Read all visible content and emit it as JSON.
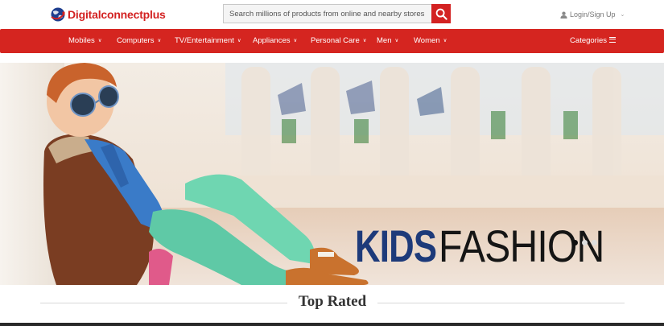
{
  "header": {
    "logo_text": "Digitalconnectplus",
    "search_placeholder": "Search millions of products from online and nearby stores",
    "login_label": "Login/Sign Up"
  },
  "nav": {
    "items": [
      {
        "label": "Mobiles"
      },
      {
        "label": "Computers"
      },
      {
        "label": "TV/Entertainment"
      },
      {
        "label": "Appliances"
      },
      {
        "label": "Personal Care"
      },
      {
        "label": "Men"
      },
      {
        "label": "Women"
      }
    ],
    "categories_label": "Categories"
  },
  "banner": {
    "title_bold": "KIDS",
    "title_light": "FASHION",
    "active_slide": 1,
    "slide_count": 3
  },
  "section": {
    "title": "Top Rated"
  },
  "colors": {
    "brand_red": "#d52520",
    "title_navy": "#1d3a7a"
  },
  "icons": [
    "globe-logo-icon",
    "search-icon",
    "user-icon",
    "chevron-down-icon",
    "hamburger-menu-icon"
  ]
}
